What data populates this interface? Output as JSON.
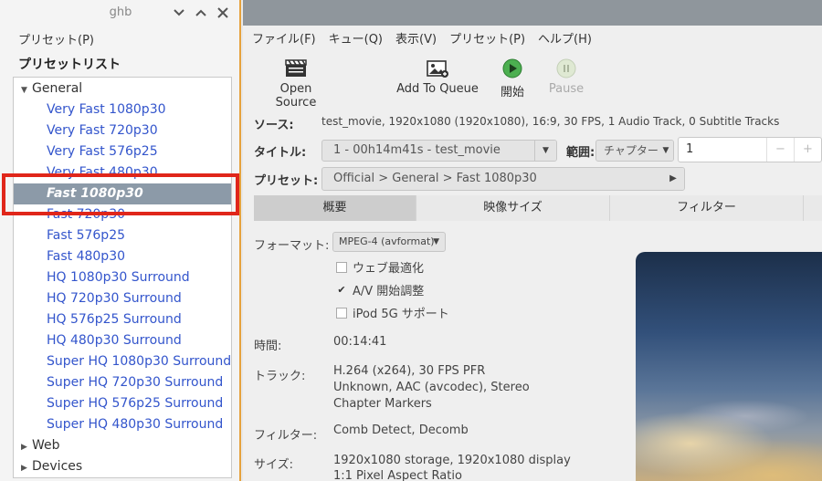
{
  "preset_panel": {
    "title": "ghb",
    "menu_label": "プリセット(P)",
    "list_heading": "プリセットリスト",
    "tree": [
      {
        "type": "group",
        "label": "General",
        "expanded": true
      },
      {
        "type": "item",
        "label": "Very Fast 1080p30"
      },
      {
        "type": "item",
        "label": "Very Fast 720p30"
      },
      {
        "type": "item",
        "label": "Very Fast 576p25"
      },
      {
        "type": "item",
        "label": "Very Fast 480p30"
      },
      {
        "type": "item",
        "label": "Fast 1080p30",
        "selected": true
      },
      {
        "type": "item",
        "label": "Fast 720p30"
      },
      {
        "type": "item",
        "label": "Fast 576p25"
      },
      {
        "type": "item",
        "label": "Fast 480p30"
      },
      {
        "type": "item",
        "label": "HQ 1080p30 Surround"
      },
      {
        "type": "item",
        "label": "HQ 720p30 Surround"
      },
      {
        "type": "item",
        "label": "HQ 576p25 Surround"
      },
      {
        "type": "item",
        "label": "HQ 480p30 Surround"
      },
      {
        "type": "item",
        "label": "Super HQ 1080p30 Surround"
      },
      {
        "type": "item",
        "label": "Super HQ 720p30 Surround"
      },
      {
        "type": "item",
        "label": "Super HQ 576p25 Surround"
      },
      {
        "type": "item",
        "label": "Super HQ 480p30 Surround"
      },
      {
        "type": "group",
        "label": "Web",
        "expanded": false
      },
      {
        "type": "group",
        "label": "Devices",
        "expanded": false
      }
    ]
  },
  "menubar": {
    "file": "ファイル(F)",
    "queue": "キュー(Q)",
    "view": "表示(V)",
    "presets": "プリセット(P)",
    "help": "ヘルプ(H)"
  },
  "toolbar": {
    "open_source": "Open Source",
    "add_to_queue": "Add To Queue",
    "start": "開始",
    "pause": "Pause"
  },
  "source": {
    "label": "ソース:",
    "value": "test_movie, 1920x1080 (1920x1080), 16:9, 30 FPS, 1 Audio Track, 0 Subtitle Tracks"
  },
  "title_row": {
    "label": "タイトル:",
    "value": "1 - 00h14m41s - test_movie",
    "range_label": "範囲:",
    "range_type": "チャプター:",
    "range_start": "1",
    "minus": "−",
    "plus": "+"
  },
  "preset_row": {
    "label": "プリセット:",
    "value": "Official > General > Fast 1080p30"
  },
  "tabs": [
    "概要",
    "映像サイズ",
    "フィルター"
  ],
  "summary": {
    "format_label": "フォーマット:",
    "format_value": "MPEG-4 (avformat)",
    "web_optimized": "ウェブ最適化",
    "av_align": "A/V 開始調整",
    "ipod": "iPod 5G サポート",
    "duration_label": "時間:",
    "duration_value": "00:14:41",
    "tracks_label": "トラック:",
    "tracks": [
      "H.264 (x264), 30 FPS PFR",
      "Unknown, AAC (avcodec), Stereo",
      "Chapter Markers"
    ],
    "filters_label": "フィルター:",
    "filters_value": "Comb Detect, Decomb",
    "size_label": "サイズ:",
    "size": [
      "1920x1080 storage, 1920x1080 display",
      "1:1 Pixel Aspect Ratio"
    ]
  },
  "colors": {
    "accent_link": "#3355cc",
    "selected_row": "#8c9aa8",
    "highlight_box": "#e0261a",
    "start_icon": "#4caf50"
  }
}
